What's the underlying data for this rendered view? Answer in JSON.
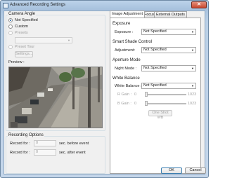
{
  "window": {
    "title": "Advanced Recording Settings",
    "close_glyph": "✕"
  },
  "camera_angle": {
    "group_label": "Camera Angle",
    "options": [
      {
        "label": "Not Specified",
        "selected": true,
        "enabled": true
      },
      {
        "label": "Custom",
        "selected": false,
        "enabled": true
      },
      {
        "label": "Presets",
        "selected": false,
        "enabled": false
      },
      {
        "label": "Preset Tour",
        "selected": false,
        "enabled": false
      }
    ],
    "settings_button": "Settings...",
    "preview_label": "Preview :"
  },
  "recording_options": {
    "group_label": "Recording Options",
    "record_for_label_1": "Record for :",
    "record_for_value_1": "0",
    "record_for_suffix_1": "sec. before event",
    "record_for_label_2": "Record for :",
    "record_for_value_2": "0",
    "record_for_suffix_2": "sec. after event"
  },
  "tabs": [
    {
      "label": "Image Adjustment",
      "active": true
    },
    {
      "label": "Focus",
      "active": false
    },
    {
      "label": "External Outputs",
      "active": false
    }
  ],
  "image_adjustment": {
    "exposure_header": "Exposure",
    "exposure_label": "Exposure :",
    "exposure_value": "Not Specified",
    "shade_header": "Smart Shade Control",
    "adjustment_label": "Adjustment:",
    "adjustment_value": "Not Specified",
    "aperture_header": "Aperture Mode",
    "night_label": "Night Mode :",
    "night_value": "Not Specified",
    "wb_header": "White Balance",
    "wb_label": "White Balance :",
    "wb_value": "Not Specified",
    "r_gain_label": "R Gain :",
    "r_gain_min": "0",
    "r_gain_max": "1023",
    "b_gain_label": "B Gain :",
    "b_gain_min": "0",
    "b_gain_max": "1023",
    "one_shot_button": "One Shot WB"
  },
  "footer": {
    "ok": "OK",
    "cancel": "Cancel"
  },
  "icons": {
    "combo_arrow": "▼"
  }
}
